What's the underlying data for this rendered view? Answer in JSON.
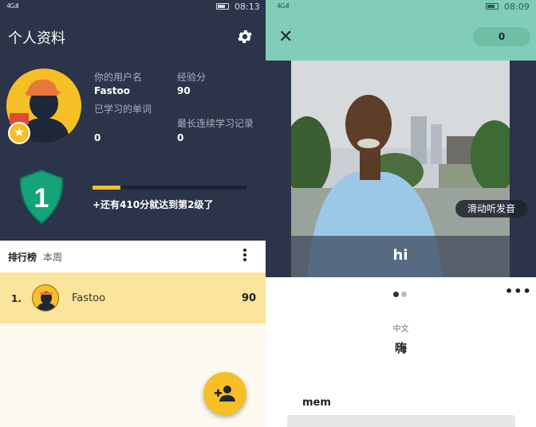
{
  "left": {
    "status": {
      "signal": "4G.ıll",
      "time": "08:13"
    },
    "title": "个人资料",
    "profile": {
      "username_label": "你的用户名",
      "username": "Fastoo",
      "xp_label": "经验分",
      "xp": "90",
      "words_label": "已学习的单词",
      "words": "0",
      "streak_label": "最长连续学习记录",
      "streak": "0"
    },
    "level": {
      "number": "1",
      "progress_fraction": 0.18,
      "next_text": "+还有410分就达到第2级了"
    },
    "leaderboard": {
      "title": "排行榜",
      "period": "本周",
      "rows": [
        {
          "rank": "1.",
          "name": "Fastoo",
          "xp": "90"
        }
      ]
    },
    "icons": {
      "settings": "gear-icon",
      "add_friend": "person-add-icon",
      "more": "more-vert-icon"
    }
  },
  "right": {
    "status": {
      "signal": "4G.ıll",
      "time": "08:09"
    },
    "score": "0",
    "video": {
      "swipe_hint": "滑动听发音",
      "caption": "hi"
    },
    "card": {
      "language_label": "中文",
      "translation": "嗨",
      "mem_label": "mem"
    },
    "icons": {
      "close": "close-icon",
      "more": "more-horiz-icon"
    }
  },
  "colors": {
    "navy": "#2b3448",
    "accent_yellow": "#f6bf25",
    "mint": "#82cdb7",
    "shield_green": "#15a37a",
    "highlight_row": "#fbe49b"
  }
}
